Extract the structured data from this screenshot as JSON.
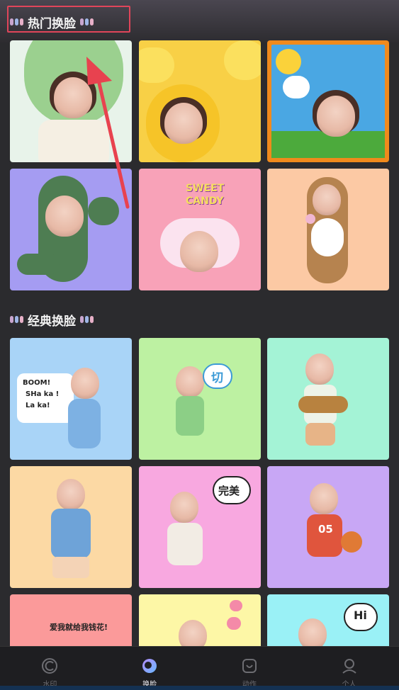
{
  "sections": {
    "hot": {
      "title": "热门换脸"
    },
    "classic": {
      "title": "经典换脸"
    }
  },
  "stickers": {
    "sweet": "SWEET",
    "candy": "CANDY",
    "boom1": "BOOM!",
    "boom2": "SHa ka !",
    "boom3": "La ka!",
    "qie": "切",
    "wanmei": "完美",
    "jersey": "05",
    "flowers": "爱我就给我钱花!",
    "hi": "Hi"
  },
  "nav": {
    "items": [
      {
        "label": "水印",
        "icon": "watermark-icon",
        "active": false
      },
      {
        "label": "换脸",
        "icon": "faceswap-icon",
        "active": true
      },
      {
        "label": "动作",
        "icon": "motion-icon",
        "active": false
      },
      {
        "label": "个人",
        "icon": "profile-icon",
        "active": false
      }
    ]
  },
  "colors": {
    "highlight": "#e0455a",
    "background": "#2b2b2e",
    "arrow": "#e8424f"
  }
}
